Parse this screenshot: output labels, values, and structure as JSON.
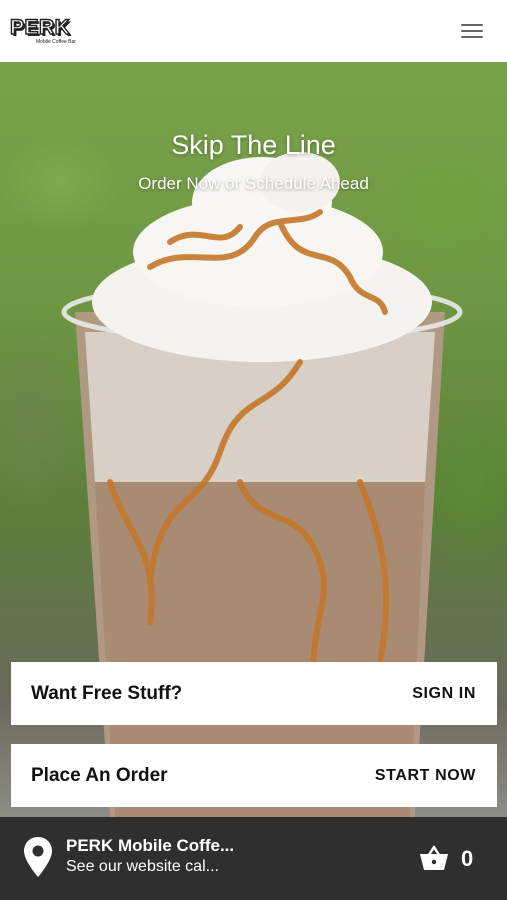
{
  "header": {
    "logo_text": "PERK",
    "logo_subtext": "Mobile Coffee Bar",
    "menu_icon": "hamburger-menu-icon"
  },
  "hero": {
    "title": "Skip The Line",
    "subtitle": "Order Now or Schedule Ahead"
  },
  "cards": [
    {
      "left_label": "Want Free Stuff?",
      "action_label": "SIGN IN"
    },
    {
      "left_label": "Place An Order",
      "action_label": "START NOW"
    }
  ],
  "footer": {
    "location_icon": "map-pin-icon",
    "location_name": "PERK Mobile Coffe...",
    "location_detail": "See our website cal...",
    "cart_icon": "basket-icon",
    "cart_count": "0"
  },
  "colors": {
    "header_bg": "#ffffff",
    "footer_bg": "#2f2f2f",
    "card_bg": "#ffffff",
    "text_dark": "#111111"
  }
}
